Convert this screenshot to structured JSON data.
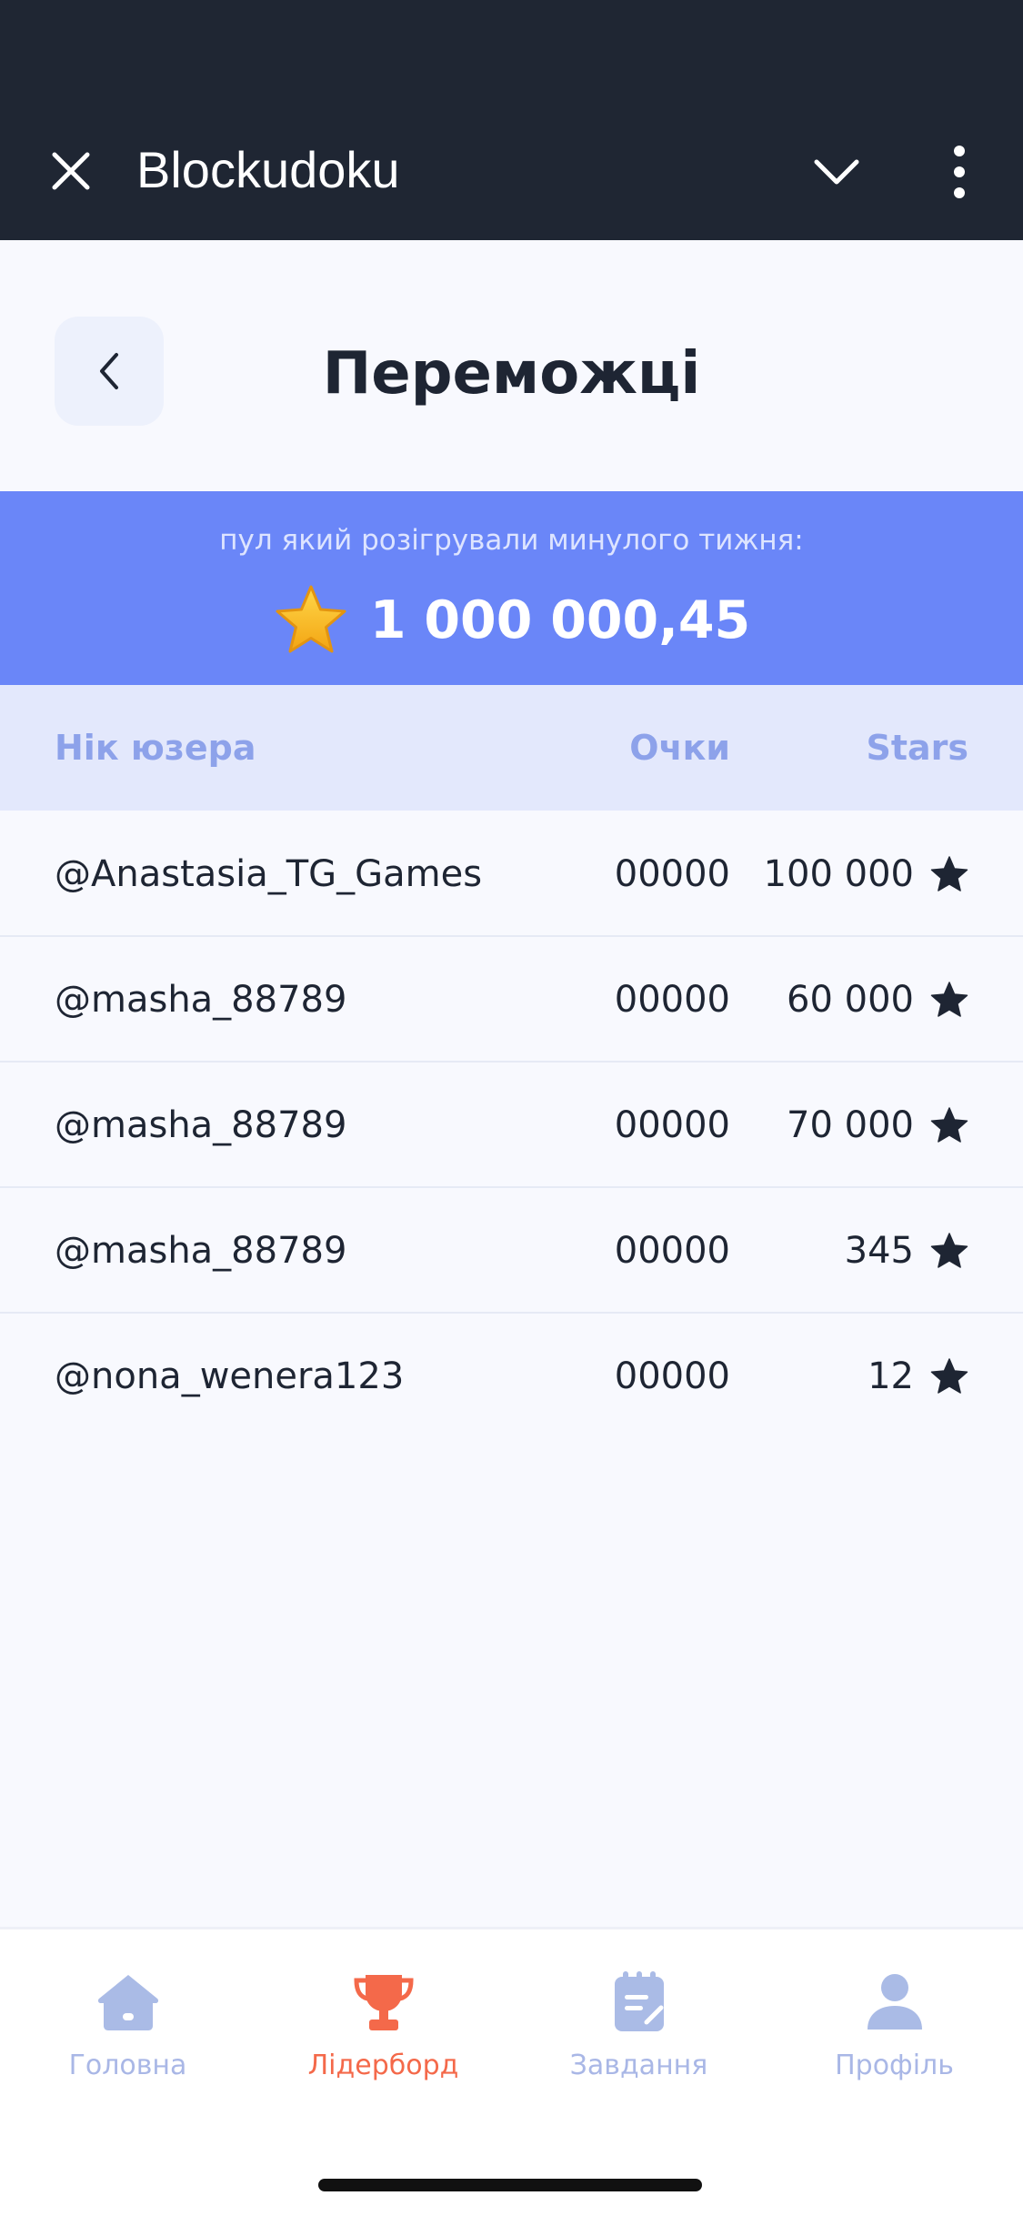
{
  "app": {
    "title": "Blockudoku"
  },
  "header": {
    "title": "Переможці"
  },
  "pool": {
    "subtitle": "пул який розігрували минулого тижня:",
    "amount": "1 000 000,45"
  },
  "table": {
    "columns": {
      "nick": "Нік юзера",
      "points": "Очки",
      "stars": "Stars"
    },
    "rows": [
      {
        "nick": "@Anastasia_TG_Games",
        "points": "00000",
        "stars": "100 000"
      },
      {
        "nick": "@masha_88789",
        "points": "00000",
        "stars": "60 000"
      },
      {
        "nick": "@masha_88789",
        "points": "00000",
        "stars": "70 000"
      },
      {
        "nick": "@masha_88789",
        "points": "00000",
        "stars": "345"
      },
      {
        "nick": "@nona_wenera123",
        "points": "00000",
        "stars": "12"
      }
    ]
  },
  "tabs": [
    {
      "label": "Головна",
      "icon": "home-icon",
      "active": false
    },
    {
      "label": "Лідерборд",
      "icon": "trophy-icon",
      "active": true
    },
    {
      "label": "Завдання",
      "icon": "tasks-icon",
      "active": false
    },
    {
      "label": "Профіль",
      "icon": "profile-icon",
      "active": false
    }
  ],
  "colors": {
    "topbar": "#1f2633",
    "banner": "#6a86f8",
    "accent": "#f4694a",
    "inactive_tab": "#a9b7e6"
  }
}
